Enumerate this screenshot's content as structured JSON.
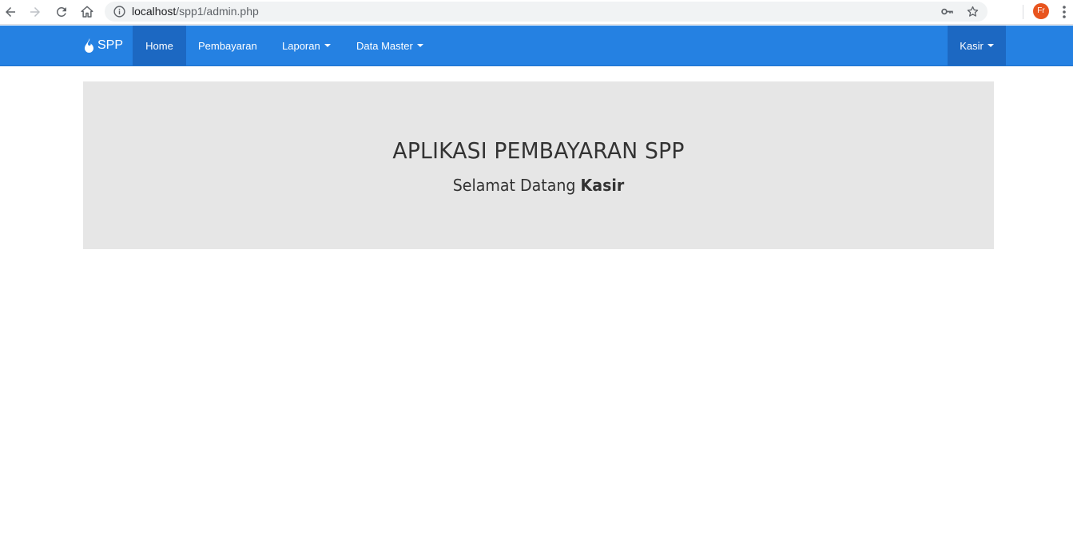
{
  "browser": {
    "url_host": "localhost",
    "url_path": "/spp1/admin.php",
    "profile_initials": "Fr"
  },
  "navbar": {
    "brand": "SPP",
    "items": [
      {
        "label": "Home",
        "active": true,
        "dropdown": false
      },
      {
        "label": "Pembayaran",
        "active": false,
        "dropdown": false
      },
      {
        "label": "Laporan",
        "active": false,
        "dropdown": true
      },
      {
        "label": "Data Master",
        "active": false,
        "dropdown": true
      }
    ],
    "user_menu": "Kasir",
    "color": "#2581e2",
    "active_color": "#1c68c2"
  },
  "jumbotron": {
    "title": "APLIKASI PEMBAYARAN SPP",
    "greeting": "Selamat Datang",
    "user": "Kasir"
  }
}
